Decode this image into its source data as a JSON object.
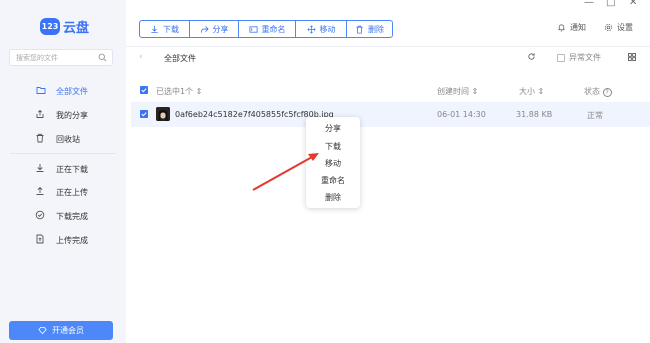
{
  "app": {
    "logo_mark": "123",
    "logo_text": "云盘"
  },
  "search": {
    "placeholder": "搜索您的文件"
  },
  "sidebar": {
    "items": [
      {
        "label": "全部文件",
        "icon": "folder-icon",
        "active": true
      },
      {
        "label": "我的分享",
        "icon": "share-icon"
      },
      {
        "label": "回收站",
        "icon": "trash-icon"
      },
      {
        "label": "正在下载",
        "icon": "download-icon"
      },
      {
        "label": "正在上传",
        "icon": "upload-icon"
      },
      {
        "label": "下载完成",
        "icon": "check-circle-icon"
      },
      {
        "label": "上传完成",
        "icon": "file-upload-icon"
      }
    ],
    "vip_label": "开通会员"
  },
  "toolbar": {
    "download": "下载",
    "share": "分享",
    "rename": "重命名",
    "move": "移动",
    "delete": "删除"
  },
  "topbar": {
    "notify": "通知",
    "settings": "设置"
  },
  "breadcrumb": {
    "current": "全部文件"
  },
  "filter": {
    "abnormal": "异常文件"
  },
  "table": {
    "headers": {
      "selected": "已选中1个",
      "created": "创建时间",
      "size": "大小",
      "status": "状态"
    },
    "rows": [
      {
        "name": "0af6eb24c5182e7f405855fc5fcf80b.jpg",
        "created": "06-01 14:30",
        "size": "31.88 KB",
        "status": "正常"
      }
    ]
  },
  "context_menu": {
    "items": [
      "分享",
      "下载",
      "移动",
      "重命名",
      "删除"
    ]
  },
  "colors": {
    "accent": "#3a73f6",
    "arrow": "#e23a2e",
    "sidebar_bg": "#f3f5fb",
    "row_selected": "#eff4fe"
  }
}
